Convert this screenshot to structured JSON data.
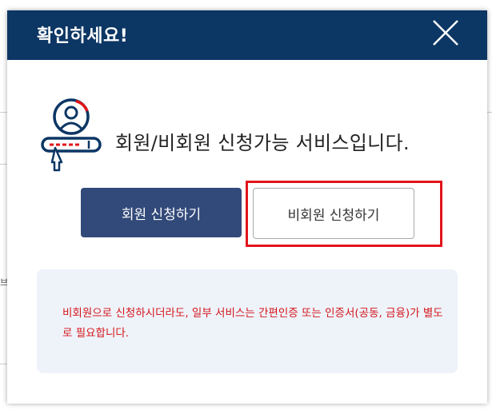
{
  "modal": {
    "title": "확인하세요!",
    "close_icon": "close-icon",
    "intro_icon": "user-login-icon",
    "intro_text": "회원/비회원 신청가능 서비스입니다.",
    "member_button_label": "회원 신청하기",
    "guest_button_label": "비회원 신청하기",
    "notice_text": "비회원으로 신청하시더라도, 일부 서비스는 간편인증 또는 인증서(공동, 금융)가 별도로 필요합니다."
  },
  "colors": {
    "header_bg": "#0c3664",
    "member_button_bg": "#324a79",
    "highlight": "#e2141b",
    "notice_text": "#d4161c",
    "notice_bg": "#eef3f9"
  },
  "background": {
    "edge_fragment": "브"
  }
}
